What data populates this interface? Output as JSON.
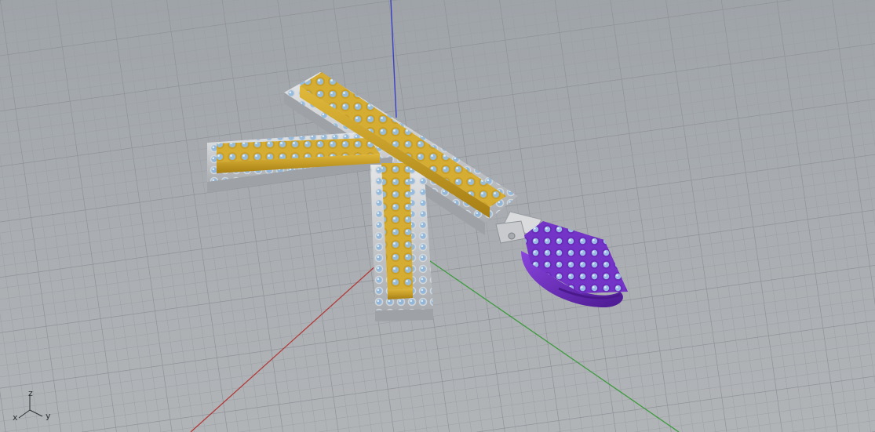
{
  "viewport": {
    "background": "#a8acb0",
    "grid_minor_color": "#9a9ea3",
    "grid_major_color": "#8e9297"
  },
  "axes": {
    "x_color": "#b23a3a",
    "y_color": "#3f9a3f",
    "z_color": "#3b3fc4"
  },
  "gizmo": {
    "z_label": "z",
    "x_label": "x",
    "y_label": "y"
  },
  "model": {
    "letter": "K",
    "gold_color": "#c9a12a",
    "silver_color": "#c7c9cc",
    "stone_color": "#8fb7dc",
    "charm_color": "#6a2bb8"
  }
}
